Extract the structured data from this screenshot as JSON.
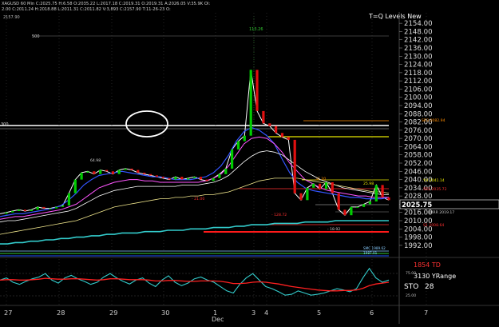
{
  "header": {
    "line1": "XAGUSD 60 Min C:2025.75 H:6.58 O:2035.22 L:2017.18 C:2019.31 O:2019.31 A:2026.05 V:35.9K OI:",
    "line2": "2.00 C:2011.24 H:2018.88 L:2011.31 C:2011.82 V:3,893 C:2157.90 T:11-26-23 O:"
  },
  "corner_price": "2157.90",
  "title": "T=Q Levels New",
  "price_axis": {
    "ticks": [
      "2154.00",
      "2148.00",
      "2142.00",
      "2136.00",
      "2130.00",
      "2124.00",
      "2118.00",
      "2112.00",
      "2106.00",
      "2100.00",
      "2094.00",
      "2088.00",
      "2082.00",
      "2076.00",
      "2070.00",
      "2064.00",
      "2058.00",
      "2052.00",
      "2046.00",
      "2040.00",
      "2034.00",
      "2028.00",
      "2022.00",
      "2016.00",
      "2010.00",
      "2004.00",
      "1998.00",
      "1992.00"
    ],
    "current_price": "2025.75",
    "min": 1989,
    "max": 2157
  },
  "time_axis": {
    "labels": [
      "27",
      "28",
      "29",
      "30",
      "1",
      "3",
      "4",
      "5",
      "6",
      "7"
    ],
    "month_label": "Dec"
  },
  "level_labels": {
    "left_300": "300",
    "top_500": "500",
    "peak": "113.26",
    "r3": "SR3 2082.94",
    "r2": "SR2 2035.72",
    "yh": "YH 2041.14",
    "yl": "YL 2009.93",
    "yesterday_mid": "Yest Mid Point 2025.",
    "rrr": "RRRR 2019.17",
    "s1_label": "S1 2008.64",
    "mid_price": "- 21.00",
    "low_price": "- 128.72",
    "price_2": "25.98",
    "price_3": "36.20",
    "price_4": "64.98",
    "price_5": "- 18.92",
    "bottom_lbl": "SMC 1989.62",
    "bottom_lbl2": "1987.01"
  },
  "indicator": {
    "td_label": "1854 TD",
    "range_label": "3130 YRange",
    "sto_label": "STO",
    "sto_value": "28",
    "lvl_75": "75.00",
    "lvl_25": "25.00"
  },
  "colors": {
    "bull": "#00cc00",
    "bear": "#e01010",
    "accent_red": "#ff2a2a",
    "yellow": "#e6e600",
    "cyan": "#33cccc",
    "orange_level": "#ff8c00"
  },
  "chart_data": {
    "type": "line",
    "title": "T=Q Levels New",
    "xlabel": "",
    "ylabel": "",
    "ylim": [
      1989,
      2157
    ],
    "x_labels": [
      "27",
      "28",
      "29",
      "30",
      "1",
      "3",
      "4",
      "5",
      "6",
      "7"
    ],
    "series": [
      {
        "values": [
          2015,
          2016,
          2017,
          2018,
          2017,
          2018,
          2020,
          2019,
          2019,
          2020,
          2021,
          2030,
          2040,
          2045,
          2046,
          2044,
          2047,
          2046,
          2044,
          2047,
          2048,
          2047,
          2045,
          2044,
          2043,
          2042,
          2041,
          2040,
          2042,
          2040,
          2041,
          2042,
          2040,
          2039,
          2041,
          2044,
          2048,
          2062,
          2068,
          2072,
          2120,
          2090,
          2081,
          2079,
          2074,
          2071,
          2069,
          2030,
          2025,
          2034,
          2037,
          2033,
          2038,
          2030,
          2018,
          2014,
          2020,
          2020,
          2022,
          2024,
          2036,
          2027,
          2025
        ]
      },
      {
        "values": [
          2013,
          2014,
          2015,
          2015,
          2016,
          2017,
          2018,
          2019,
          2021,
          2025,
          2030,
          2036,
          2040,
          2043,
          2044,
          2045,
          2046,
          2045,
          2044,
          2043,
          2042,
          2042,
          2041,
          2040,
          2040,
          2040,
          2041,
          2042,
          2045,
          2050,
          2058,
          2068,
          2075,
          2078,
          2076,
          2072,
          2066,
          2055,
          2045,
          2038,
          2034,
          2032,
          2031,
          2030,
          2029,
          2028,
          2027,
          2027,
          2026,
          2026,
          2026,
          2027
        ]
      },
      {
        "values": [
          2011,
          2012,
          2013,
          2013,
          2014,
          2015,
          2016,
          2017,
          2018,
          2020,
          2022,
          2026,
          2030,
          2034,
          2036,
          2038,
          2039,
          2040,
          2040,
          2039,
          2039,
          2038,
          2038,
          2038,
          2038,
          2038,
          2038,
          2039,
          2041,
          2044,
          2050,
          2058,
          2066,
          2070,
          2071,
          2070,
          2066,
          2060,
          2052,
          2046,
          2040,
          2037,
          2034,
          2032,
          2031,
          2030,
          2029,
          2028,
          2028,
          2027,
          2027,
          2027
        ]
      },
      {
        "values": [
          2009,
          2010,
          2010,
          2011,
          2012,
          2013,
          2014,
          2015,
          2016,
          2017,
          2019,
          2022,
          2025,
          2028,
          2030,
          2032,
          2033,
          2034,
          2035,
          2035,
          2035,
          2035,
          2035,
          2035,
          2036,
          2036,
          2036,
          2037,
          2038,
          2040,
          2043,
          2048,
          2053,
          2057,
          2060,
          2061,
          2060,
          2058,
          2054,
          2050,
          2046,
          2043,
          2040,
          2038,
          2036,
          2034,
          2033,
          2032,
          2031,
          2030,
          2029,
          2029
        ]
      },
      {
        "values": [
          2000,
          2001,
          2002,
          2003,
          2004,
          2005,
          2006,
          2007,
          2008,
          2009,
          2010,
          2012,
          2014,
          2016,
          2018,
          2020,
          2021,
          2022,
          2023,
          2024,
          2025,
          2026,
          2026,
          2027,
          2027,
          2028,
          2028,
          2029,
          2029,
          2030,
          2031,
          2033,
          2035,
          2037,
          2039,
          2040,
          2041,
          2041,
          2041,
          2041,
          2040,
          2039,
          2038,
          2037,
          2036,
          2035,
          2034,
          2033,
          2032,
          2031,
          2031,
          2030
        ]
      },
      {
        "values": [
          1993,
          1993,
          1994,
          1994,
          1995,
          1995,
          1996,
          1996,
          1997,
          1997,
          1998,
          1998,
          1999,
          1999,
          2000,
          2000,
          2001,
          2001,
          2001,
          2002,
          2002,
          2002,
          2003,
          2003,
          2003,
          2004,
          2004,
          2004,
          2005,
          2005,
          2005,
          2006,
          2006,
          2007,
          2007,
          2007,
          2008,
          2008,
          2008,
          2008,
          2009,
          2009,
          2009,
          2009,
          2010,
          2010,
          2010,
          2010,
          2010,
          2010,
          2010,
          2010
        ]
      }
    ],
    "oscillator": {
      "ylim": [
        0,
        100
      ],
      "values": [
        55,
        60,
        50,
        45,
        52,
        58,
        62,
        70,
        55,
        48,
        60,
        66,
        58,
        52,
        45,
        50,
        62,
        70,
        60,
        52,
        46,
        55,
        60,
        48,
        40,
        55,
        65,
        50,
        42,
        48,
        58,
        62,
        55,
        50,
        40,
        30,
        25,
        45,
        60,
        70,
        55,
        40,
        35,
        28,
        20,
        22,
        30,
        25,
        20,
        22,
        25,
        30,
        35,
        32,
        28,
        35,
        60,
        82,
        60,
        50,
        55
      ],
      "signal": [
        55,
        56,
        56,
        55,
        55,
        56,
        57,
        59,
        58,
        57,
        57,
        58,
        58,
        57,
        56,
        55,
        56,
        58,
        58,
        57,
        56,
        56,
        56,
        55,
        53,
        53,
        54,
        54,
        53,
        52,
        52,
        53,
        53,
        53,
        52,
        50,
        47,
        47,
        48,
        50,
        51,
        50,
        48,
        46,
        43,
        40,
        38,
        36,
        34,
        32,
        31,
        30,
        30,
        31,
        31,
        32,
        36,
        42,
        46,
        48,
        50
      ]
    }
  }
}
